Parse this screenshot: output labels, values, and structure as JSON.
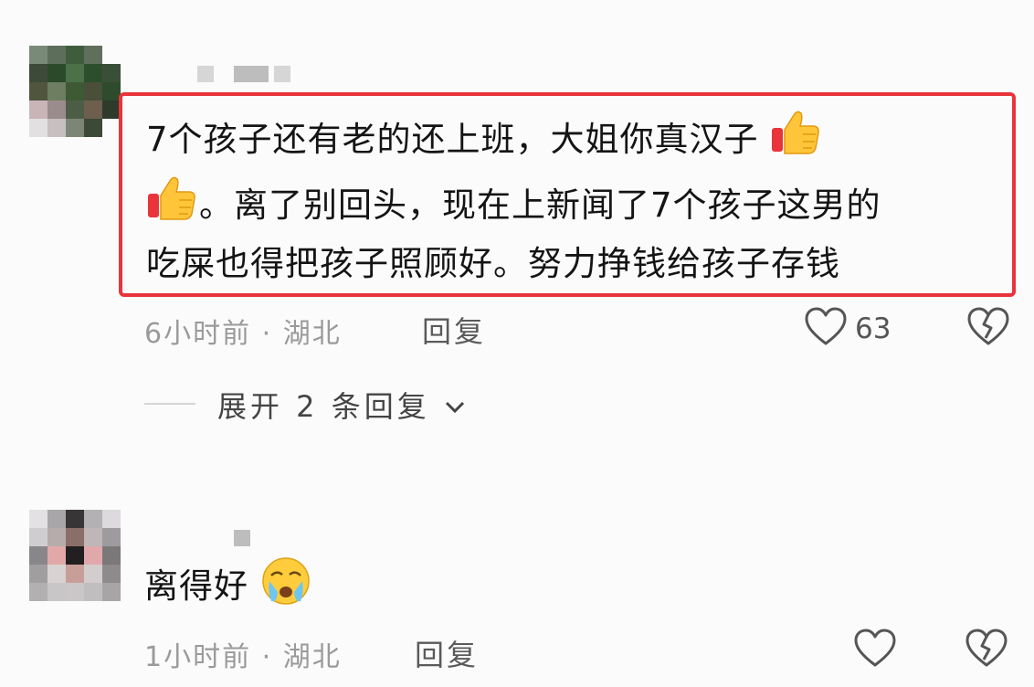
{
  "comments": [
    {
      "lines": [
        "7个孩子还有老的还上班，大姐你真汉子",
        "。离了别回头，现在上新闻了7个孩子这男的",
        "吃屎也得把孩子照顾好。努力挣钱给孩子存钱"
      ],
      "emojis": [
        "thumbs-up-emoji",
        "thumbs-up-emoji"
      ],
      "time": "6小时前",
      "separator": "·",
      "location": "湖北",
      "reply_label": "回复",
      "likes": "63",
      "expand_label": "展开 2 条回复"
    },
    {
      "lines": [
        "离得好"
      ],
      "emojis": [
        "crying-face-emoji"
      ],
      "time": "1小时前",
      "separator": "·",
      "location": "湖北",
      "reply_label": "回复"
    }
  ],
  "colors": {
    "highlight_border": "#e8343a",
    "meta_text": "#9a9a9a",
    "background": "#fbfbfb"
  }
}
